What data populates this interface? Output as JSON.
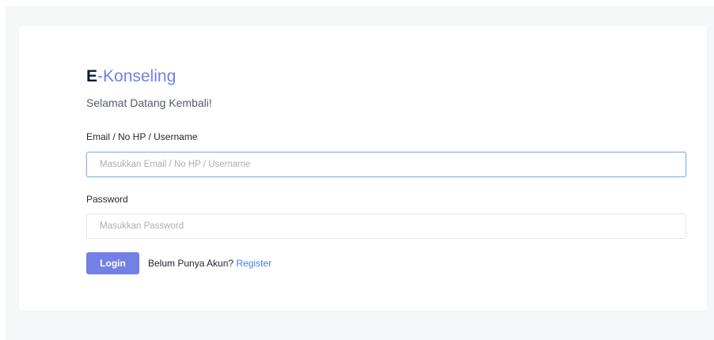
{
  "brand": {
    "letter": "E",
    "suffix": "-Konseling"
  },
  "welcome_text": "Selamat Datang Kembali!",
  "form": {
    "email": {
      "label": "Email / No HP / Username",
      "placeholder": "Masukkan Email / No HP / Username",
      "value": ""
    },
    "password": {
      "label": "Password",
      "placeholder": "Masukkan Password",
      "value": ""
    },
    "login_label": "Login",
    "register_prompt": "Belum Punya Akun?",
    "register_link": "Register"
  },
  "colors": {
    "accent": "#7380e5",
    "brand_letter": "#111a3a",
    "link": "#3f7fe0",
    "focus_border": "#8ab6e6",
    "page_background": "#f6f7f9"
  }
}
